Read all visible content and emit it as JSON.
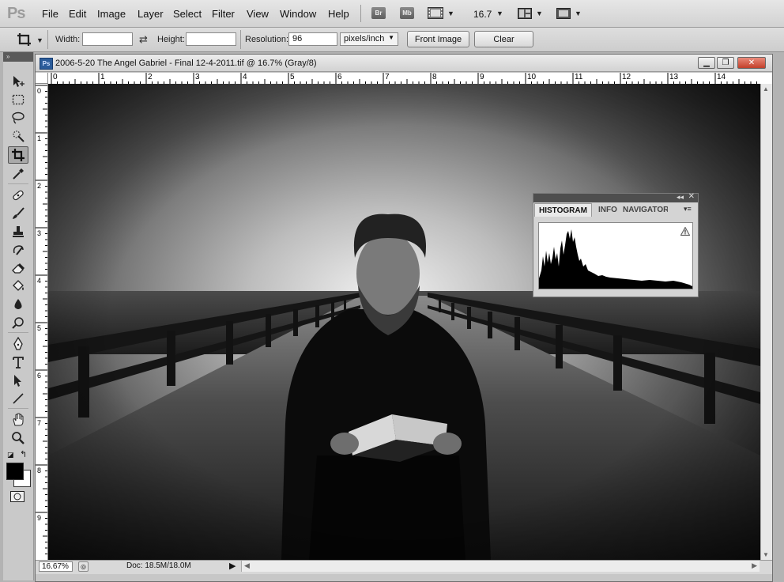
{
  "app": {
    "logo": "Ps"
  },
  "menu": [
    "File",
    "Edit",
    "Image",
    "Layer",
    "Select",
    "Filter",
    "View",
    "Window",
    "Help"
  ],
  "menubar_buttons": {
    "bridge": "Br",
    "minibridge": "Mb",
    "zoom": "16.7"
  },
  "options": {
    "width_label": "Width:",
    "width_value": "",
    "height_label": "Height:",
    "height_value": "",
    "resolution_label": "Resolution:",
    "resolution_value": "96",
    "units": "pixels/inch",
    "front_image": "Front Image",
    "clear": "Clear"
  },
  "toolbar": {
    "tools": [
      "move-tool",
      "rect-marquee-tool",
      "lasso-tool",
      "quick-select-tool",
      "crop-tool",
      "eyedropper-tool",
      "healing-brush-tool",
      "brush-tool",
      "clone-stamp-tool",
      "history-brush-tool",
      "eraser-tool",
      "paint-bucket-tool",
      "blur-tool",
      "dodge-tool",
      "pen-tool",
      "type-tool",
      "path-select-tool",
      "line-tool",
      "hand-tool",
      "zoom-tool"
    ],
    "active": "crop-tool",
    "foreground_color": "#000000",
    "background_color": "#ffffff"
  },
  "document": {
    "badge": "Ps",
    "title": "2006-5-20 The Angel Gabriel - Final 12-4-2011.tif @ 16.7% (Gray/8)",
    "zoom_status": "16.67%",
    "doc_size": "Doc: 18.5M/18.0M"
  },
  "rulers": {
    "horizontal": [
      "0",
      "1",
      "2",
      "3",
      "4",
      "5",
      "6",
      "7",
      "8",
      "9",
      "10",
      "11",
      "12",
      "13",
      "14"
    ],
    "vertical": [
      "0",
      "1",
      "2",
      "3",
      "4",
      "5",
      "6",
      "7",
      "8",
      "9"
    ]
  },
  "panel": {
    "tabs": [
      "HISTOGRAM",
      "INFO",
      "NAVIGATOR"
    ],
    "active_tab": "HISTOGRAM"
  }
}
